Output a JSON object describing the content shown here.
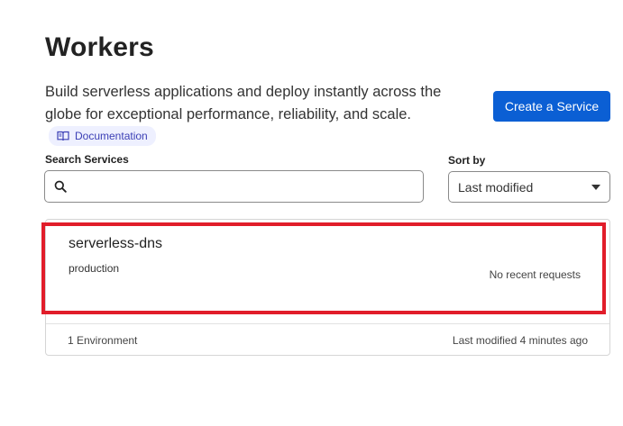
{
  "page": {
    "title": "Workers",
    "description": "Build serverless applications and deploy instantly across the globe for exceptional performance, reliability, and scale.",
    "documentation_label": "Documentation",
    "create_button_label": "Create a Service"
  },
  "search": {
    "label": "Search Services",
    "value": "",
    "placeholder": ""
  },
  "sort": {
    "label": "Sort by",
    "selected": "Last modified"
  },
  "services": [
    {
      "name": "serverless-dns",
      "environment": "production",
      "requests_status": "No recent requests",
      "environment_count": "1 Environment",
      "last_modified": "Last modified 4 minutes ago"
    }
  ],
  "colors": {
    "primary_button": "#0b5fd4",
    "highlight_border": "#e11d2a",
    "doc_badge_bg": "#eef0ff",
    "doc_badge_text": "#3b3fb5"
  },
  "icons": {
    "search": "search-icon",
    "documentation": "book-icon",
    "dropdown": "chevron-down-icon"
  }
}
